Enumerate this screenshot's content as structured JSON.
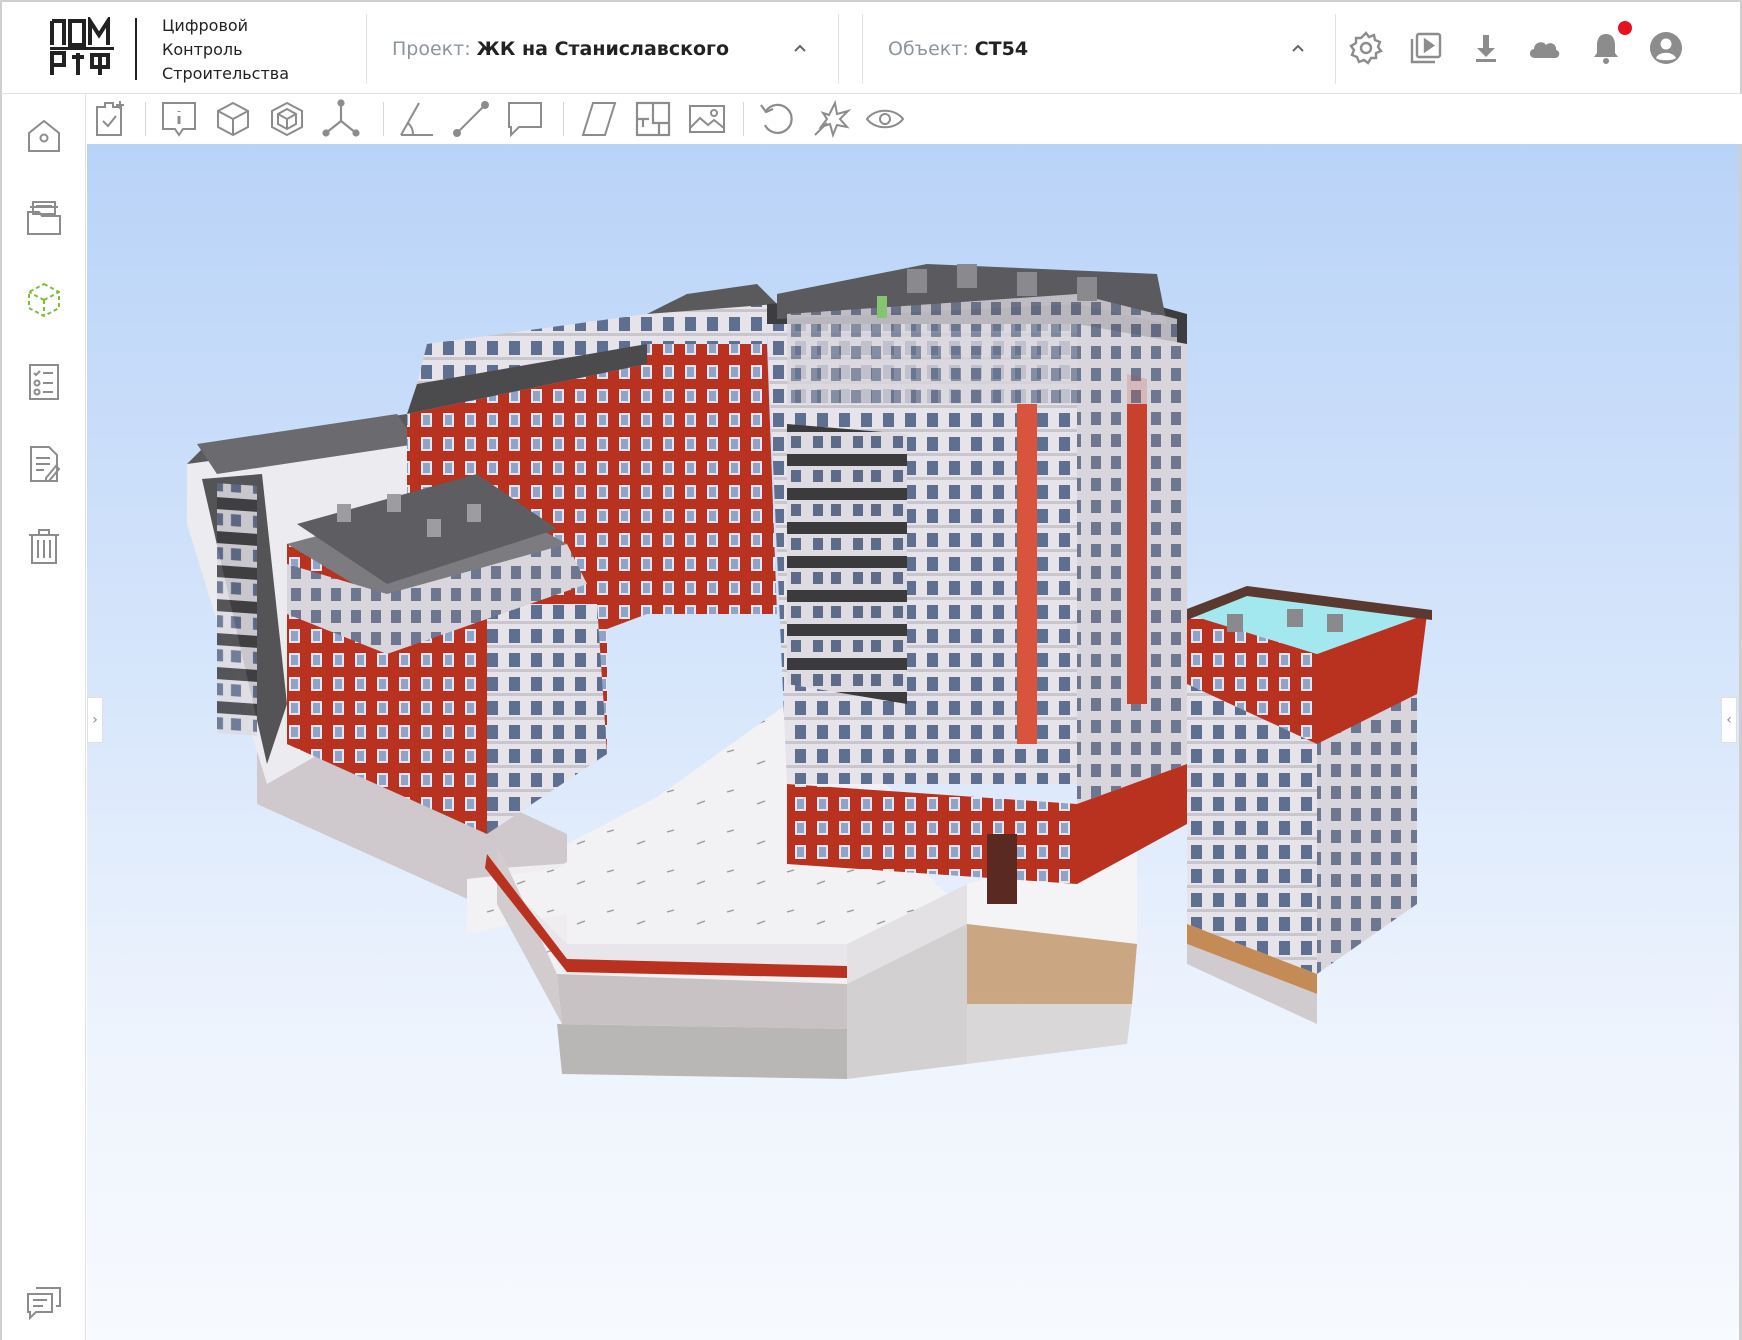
{
  "brand": {
    "lines": [
      "Цифровой",
      "Контроль",
      "Строительства"
    ]
  },
  "project": {
    "label": "Проект:",
    "value": "ЖК на Станиславского"
  },
  "object": {
    "label": "Объект:",
    "value": "СТ54"
  },
  "header_icons": [
    "gear-icon",
    "video-library-icon",
    "download-icon",
    "cloud-icon",
    "bell-icon",
    "user-avatar-icon"
  ],
  "notifications": {
    "has_unread": true,
    "dot_color": "#e8101e"
  },
  "sidebar": {
    "items": [
      {
        "name": "home",
        "icon": "home-icon",
        "active": false
      },
      {
        "name": "documents",
        "icon": "folders-icon",
        "active": false
      },
      {
        "name": "model",
        "icon": "3d-cube-icon",
        "active": true
      },
      {
        "name": "checklists",
        "icon": "checklist-icon",
        "active": false
      },
      {
        "name": "reports",
        "icon": "document-edit-icon",
        "active": false
      },
      {
        "name": "trash",
        "icon": "trash-icon",
        "active": false
      }
    ],
    "bottom": {
      "name": "chat",
      "icon": "chat-icon"
    }
  },
  "toolbar": {
    "tools": [
      "task-check-icon",
      "info-icon",
      "box-icon",
      "box-wire-icon",
      "axes-icon",
      "angle-measure-icon",
      "distance-measure-icon",
      "comment-icon",
      "section-plane-icon",
      "floor-plan-icon",
      "image-icon",
      "reset-view-icon",
      "explode-icon",
      "visibility-icon"
    ]
  },
  "colors": {
    "accent_active": "#7bbf3a",
    "icon_gray": "#8c8c8c",
    "sky_top": "#b9d3f8",
    "brick_red": "#b8321f"
  }
}
